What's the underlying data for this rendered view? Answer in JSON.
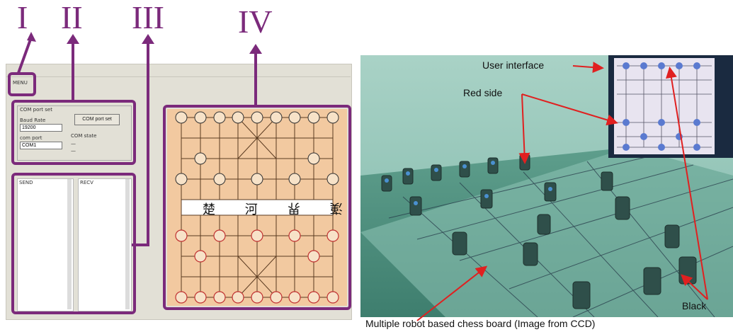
{
  "labels": {
    "roman1": "I",
    "roman2": "II",
    "roman3": "III",
    "roman4": "IV"
  },
  "software": {
    "menu_label": "MENU",
    "com_group_title": "COM port set",
    "baud_label": "Baud Rate",
    "baud_value": "19200",
    "com_label": "com port",
    "com_value": "COM1",
    "port_button": "COM port set",
    "state_label": "COM state",
    "state_line1": "—",
    "state_line2": "—",
    "log_left_title": "SEND",
    "log_right_title": "RECV",
    "river_left": "楚 河",
    "river_right": "漢 界"
  },
  "photo": {
    "label_ui": "User interface",
    "label_red": "Red side",
    "label_black": "Black",
    "caption": "Multiple robot based chess board (Image from CCD)"
  },
  "colors": {
    "accent": "#7b2a7b",
    "board": "#f2c9a0",
    "arrow": "#e02020"
  }
}
